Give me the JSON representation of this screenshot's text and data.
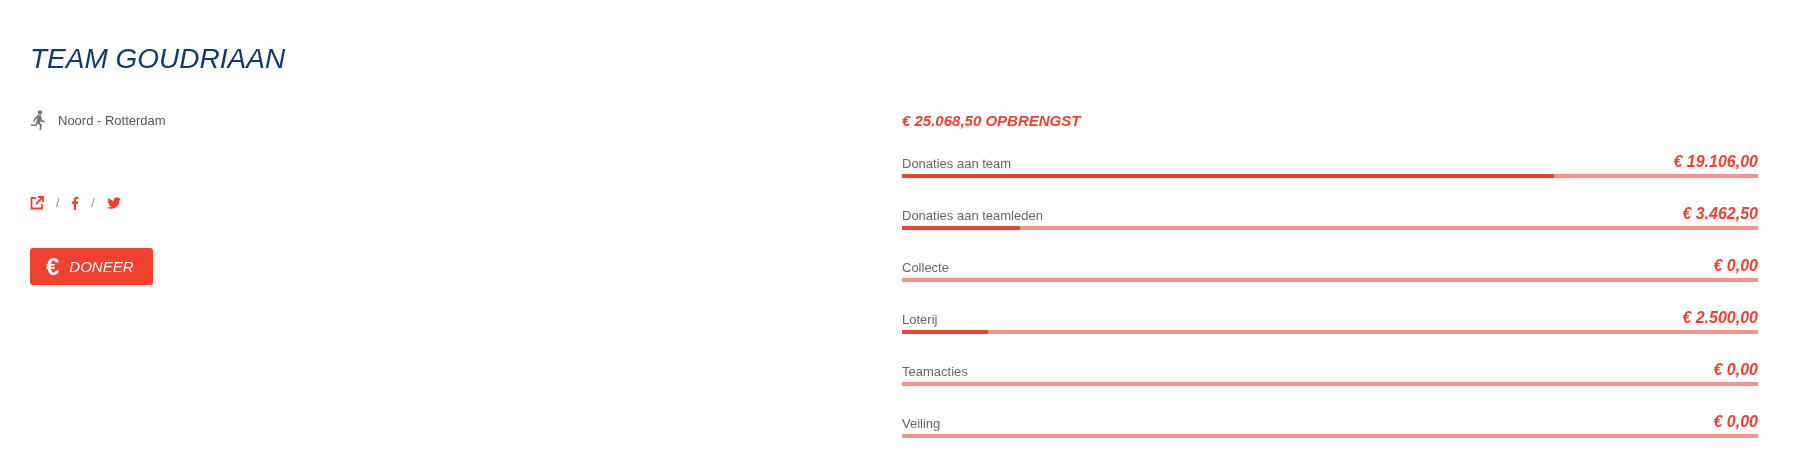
{
  "team": {
    "title": "TEAM GOUDRIAAN",
    "location": "Noord - Rotterdam",
    "share_separators": [
      "/",
      "/"
    ],
    "donate_icon": "€",
    "donate_button": "DONEER"
  },
  "revenue": {
    "total": "€ 25.068,50 OPBRENGST",
    "items": [
      {
        "label": "Donaties aan team",
        "amount": "€ 19.106,00",
        "level": 0.762
      },
      {
        "label": "Donaties aan teamleden",
        "amount": "€ 3.462,50",
        "level": 0.138
      },
      {
        "label": "Collecte",
        "amount": "€ 0,00"
      },
      {
        "label": "Loterij",
        "amount": "€ 2.500,00",
        "level": 0.1
      },
      {
        "label": "Teamacties",
        "amount": "€ 0,00"
      },
      {
        "label": "Veiling",
        "amount": "€ 0,00"
      }
    ]
  }
}
